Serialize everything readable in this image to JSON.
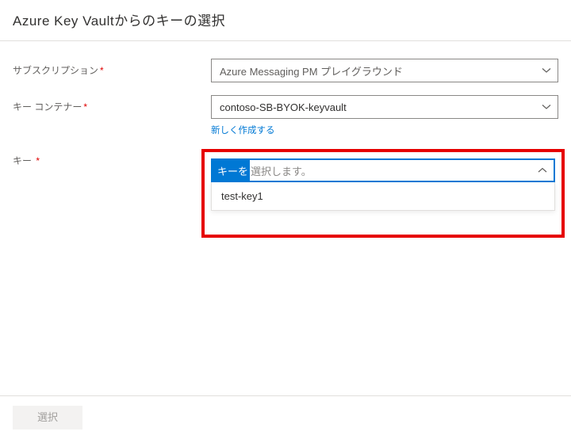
{
  "header": {
    "title": "Azure Key Vaultからのキーの選択"
  },
  "subscription": {
    "label": "サブスクリプション",
    "value": "Azure Messaging PM プレイグラウンド"
  },
  "keyvault": {
    "label": "キー コンテナー",
    "value": "contoso-SB-BYOK-keyvault",
    "create_new_link": "新しく作成する"
  },
  "key": {
    "label": "キー",
    "placeholder_highlight": "キーを",
    "placeholder_rest": "選択します。",
    "options": [
      "test-key1"
    ]
  },
  "footer": {
    "select_button": "選択"
  }
}
